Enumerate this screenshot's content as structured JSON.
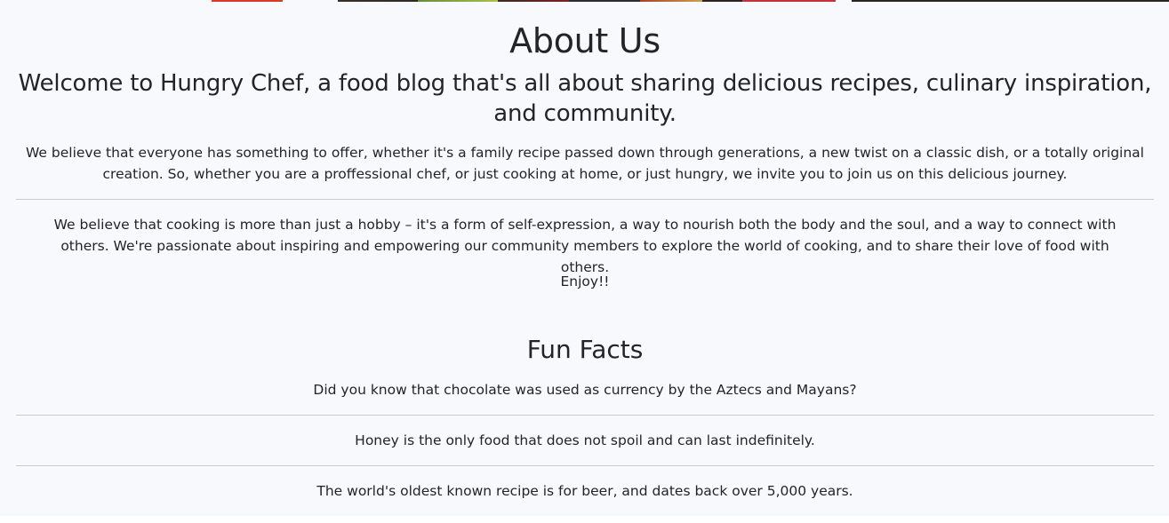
{
  "about": {
    "title": "About Us",
    "welcome": "Welcome to Hungry Chef, a food blog that's all about sharing delicious recipes, culinary inspiration, and community.",
    "paragraph_1": "We believe that everyone has something to offer, whether it's a family recipe passed down through generations, a new twist on a classic dish, or a totally original creation. So, whether you are a proffessional chef, or just cooking at home, or just hungry, we invite you to join us on this delicious journey.",
    "paragraph_2": "We believe that cooking is more than just a hobby – it's a form of self-expression, a way to nourish both the body and the soul, and a way to connect with others. We're passionate about inspiring and empowering our community members to explore the world of cooking, and to share their love of food with others.",
    "enjoy": "Enjoy!!"
  },
  "fun_facts": {
    "title": "Fun Facts",
    "facts": [
      "Did you know that chocolate was used as currency by the Aztecs and Mayans?",
      "Honey is the only food that does not spoil and can last indefinitely.",
      "The world's oldest known recipe is for beer, and dates back over 5,000 years."
    ]
  }
}
